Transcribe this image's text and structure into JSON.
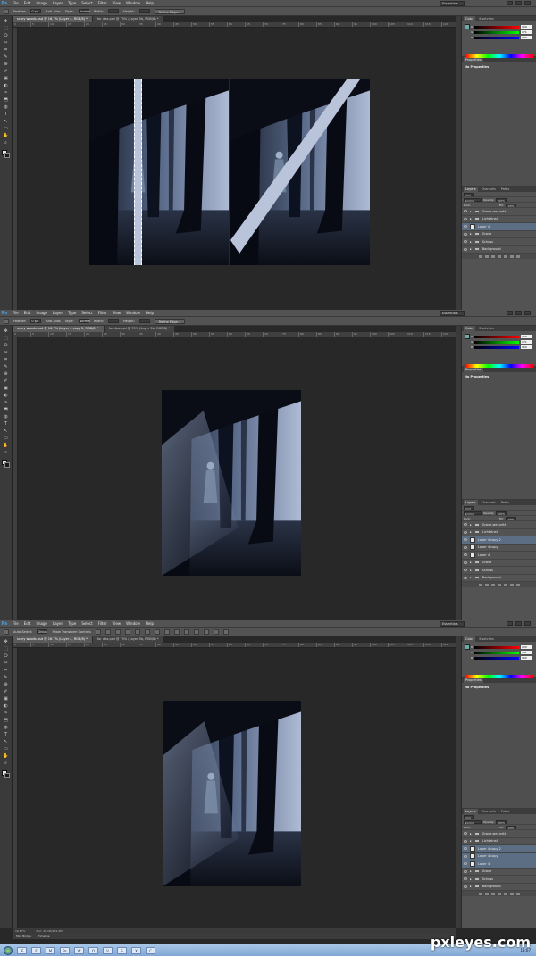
{
  "app": {
    "logo": "Ps",
    "menu": [
      "File",
      "Edit",
      "Image",
      "Layer",
      "Type",
      "Select",
      "Filter",
      "View",
      "Window",
      "Help"
    ],
    "workspace": "Essentials"
  },
  "screens": [
    {
      "options": {
        "feather_label": "Feather:",
        "feather_value": "0 px",
        "antialias": "Anti-alias",
        "style_label": "Style:",
        "style_value": "Normal",
        "width_label": "Width:",
        "height_label": "Height:",
        "refine_edge": "Refine Edge..."
      },
      "tabs": [
        "scary woods.psd @ 16.7% (Layer 4, RGB/8) *",
        "for dea.psd @ 75% (Layer 5b, RGB/8) *"
      ],
      "properties_title": "No Properties",
      "layers": [
        {
          "name": "Grave-wer-nett",
          "type": "folder",
          "selected": false
        },
        {
          "name": "Lichteinall",
          "type": "folder",
          "selected": false
        },
        {
          "name": "Layer 4",
          "type": "layer",
          "selected": true
        },
        {
          "name": "Grave",
          "type": "folder",
          "selected": false
        },
        {
          "name": "Schuss",
          "type": "folder",
          "selected": false
        },
        {
          "name": "Background",
          "type": "folder",
          "selected": false
        }
      ]
    },
    {
      "options": {
        "feather_label": "Feather:",
        "feather_value": "0 px",
        "antialias": "Anti-alias",
        "style_label": "Style:",
        "style_value": "Normal",
        "width_label": "Width:",
        "height_label": "Height:",
        "refine_edge": "Refine Edge..."
      },
      "tabs": [
        "scary woods.psd @ 16.7% (Layer 4 copy 2, RGB/8) *",
        "for dea.psd @ 75% (Layer 5b, RGB/8) *"
      ],
      "properties_title": "No Properties",
      "layers": [
        {
          "name": "Grave-wer-nett",
          "type": "folder",
          "selected": false
        },
        {
          "name": "Lichteinall",
          "type": "folder",
          "selected": false
        },
        {
          "name": "Layer 4 copy 2",
          "type": "layer",
          "selected": true
        },
        {
          "name": "Layer 4 copy",
          "type": "layer",
          "selected": false
        },
        {
          "name": "Layer 4",
          "type": "layer",
          "selected": false
        },
        {
          "name": "Grave",
          "type": "folder",
          "selected": false
        },
        {
          "name": "Schuss",
          "type": "folder",
          "selected": false
        },
        {
          "name": "Background",
          "type": "folder",
          "selected": false
        }
      ]
    },
    {
      "options": {
        "auto_select": "Auto-Select:",
        "group": "Group",
        "transform": "Show Transform Controls"
      },
      "tabs": [
        "scary woods.psd @ 16.7% (Layer 4, RGB/8) *",
        "for dea.psd @ 75% (Layer 5b, RGB/8) *"
      ],
      "properties_title": "No Properties",
      "layers": [
        {
          "name": "Grave-wer-nett",
          "type": "folder",
          "selected": false
        },
        {
          "name": "Lichteinall",
          "type": "folder",
          "selected": false
        },
        {
          "name": "Layer 4 copy 2",
          "type": "layer",
          "selected": true
        },
        {
          "name": "Layer 4 copy",
          "type": "layer",
          "selected": true
        },
        {
          "name": "Layer 4",
          "type": "layer",
          "selected": true
        },
        {
          "name": "Grave",
          "type": "folder",
          "selected": false
        },
        {
          "name": "Schuss",
          "type": "folder",
          "selected": false
        },
        {
          "name": "Background",
          "type": "folder",
          "selected": false
        }
      ],
      "status": {
        "zoom": "16.67%",
        "doc": "Doc: 26.1M/154.4M"
      },
      "bottom_tabs": [
        "Mini Bridge",
        "Timeline"
      ]
    }
  ],
  "panel_labels": {
    "color_tab": "Color",
    "swatches_tab": "Swatches",
    "properties_tab": "Properties",
    "layers_tab": "Layers",
    "channels_tab": "Channels",
    "paths_tab": "Paths",
    "kind": "Kind",
    "blend": "Normal",
    "opacity_label": "Opacity:",
    "opacity": "100%",
    "lock_label": "Lock:",
    "fill_label": "Fill:",
    "fill": "100%",
    "r": "R",
    "g": "G",
    "b": "B",
    "r_val": "109",
    "g_val": "171",
    "b_val": "160"
  },
  "watermark": "pxleyes.com",
  "taskbar_clock": "13:07"
}
